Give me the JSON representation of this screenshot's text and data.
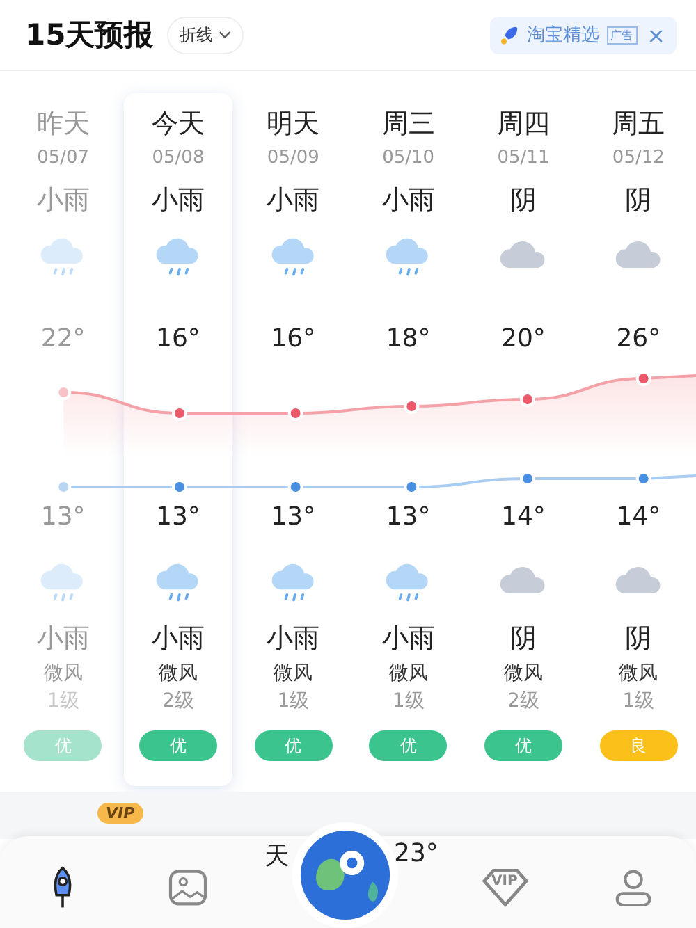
{
  "header": {
    "title": "15天预报",
    "view_toggle": "折线",
    "ad": {
      "label": "淘宝精选",
      "tag": "广告",
      "close": "×"
    }
  },
  "days": [
    {
      "name": "昨天",
      "date": "05/07",
      "day_condition": "小雨",
      "day_icon": {
        "kind": "rain"
      },
      "high": "22°",
      "low": "13°",
      "night_icon": {
        "kind": "rain"
      },
      "night_condition": "小雨",
      "wind": "微风",
      "wind_level": "1级",
      "aqi": {
        "text": "优",
        "color": "#a6e3cd"
      },
      "past": true,
      "selected": false
    },
    {
      "name": "今天",
      "date": "05/08",
      "day_condition": "小雨",
      "day_icon": {
        "kind": "rain"
      },
      "high": "16°",
      "low": "13°",
      "night_icon": {
        "kind": "rain"
      },
      "night_condition": "小雨",
      "wind": "微风",
      "wind_level": "2级",
      "aqi": {
        "text": "优",
        "color": "#3cc48f"
      },
      "past": false,
      "selected": true
    },
    {
      "name": "明天",
      "date": "05/09",
      "day_condition": "小雨",
      "day_icon": {
        "kind": "rain"
      },
      "high": "16°",
      "low": "13°",
      "night_icon": {
        "kind": "rain"
      },
      "night_condition": "小雨",
      "wind": "微风",
      "wind_level": "1级",
      "aqi": {
        "text": "优",
        "color": "#3cc48f"
      },
      "past": false,
      "selected": false
    },
    {
      "name": "周三",
      "date": "05/10",
      "day_condition": "小雨",
      "day_icon": {
        "kind": "rain"
      },
      "high": "18°",
      "low": "13°",
      "night_icon": {
        "kind": "rain"
      },
      "night_condition": "小雨",
      "wind": "微风",
      "wind_level": "1级",
      "aqi": {
        "text": "优",
        "color": "#3cc48f"
      },
      "past": false,
      "selected": false
    },
    {
      "name": "周四",
      "date": "05/11",
      "day_condition": "阴",
      "day_icon": {
        "kind": "cloudy"
      },
      "high": "20°",
      "low": "14°",
      "night_icon": {
        "kind": "cloudy"
      },
      "night_condition": "阴",
      "wind": "微风",
      "wind_level": "2级",
      "aqi": {
        "text": "优",
        "color": "#3cc48f"
      },
      "past": false,
      "selected": false
    },
    {
      "name": "周五",
      "date": "05/12",
      "day_condition": "阴",
      "day_icon": {
        "kind": "cloudy"
      },
      "high": "26°",
      "low": "14°",
      "night_icon": {
        "kind": "cloudy"
      },
      "night_condition": "阴",
      "wind": "微风",
      "wind_level": "1级",
      "aqi": {
        "text": "良",
        "color": "#fbc11a"
      },
      "past": false,
      "selected": false
    }
  ],
  "bottom_peek": {
    "badge": "VIP",
    "text_1": "天",
    "text_2": "23°"
  },
  "nav": [
    {
      "kind": "rocket",
      "selected": true
    },
    {
      "kind": "picture",
      "selected": false
    },
    {
      "kind": "globe",
      "selected": false
    },
    {
      "kind": "vip",
      "label": "VIP",
      "selected": false
    },
    {
      "kind": "person",
      "selected": false
    }
  ]
}
